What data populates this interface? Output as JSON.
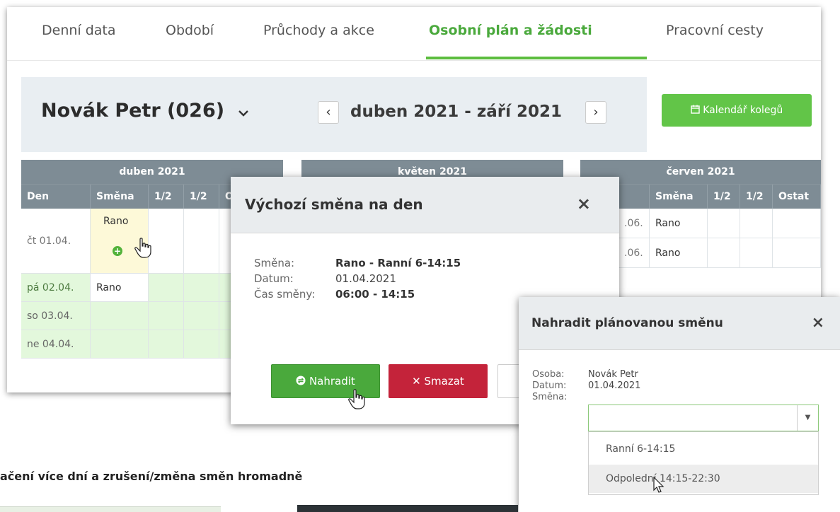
{
  "tabs": [
    {
      "label": "Denní data"
    },
    {
      "label": "Období"
    },
    {
      "label": "Průchody a akce"
    },
    {
      "label": "Osobní plán a žádosti",
      "active": true
    },
    {
      "label": "Pracovní cesty"
    }
  ],
  "header": {
    "person": "Novák Petr (026)",
    "period": "duben 2021 - září 2021",
    "prev_icon": "‹",
    "next_icon": "›",
    "colleagues_button": "Kalendář kolegů"
  },
  "months": [
    {
      "title": "duben 2021",
      "columns": [
        "Den",
        "Směna",
        "1/2",
        "1/2",
        "O"
      ],
      "rows": [
        {
          "day": "čt 01.04.",
          "shift": "Rano",
          "weekend": false
        },
        {
          "day": "pá 02.04.",
          "shift": "Rano",
          "weekend": false
        },
        {
          "day": "so 03.04.",
          "shift": "",
          "weekend": true
        },
        {
          "day": "ne 04.04.",
          "shift": "",
          "weekend": true
        }
      ]
    },
    {
      "title": "květen 2021"
    },
    {
      "title": "červen 2021",
      "columns": [
        "Směna",
        "1/2",
        "1/2",
        "Ostat"
      ],
      "rows": [
        {
          "day": ".06.",
          "shift": "Rano"
        },
        {
          "day": ".06.",
          "shift": "Rano"
        }
      ]
    }
  ],
  "dialog_default_shift": {
    "title": "Výchozí směna na den",
    "close": "×",
    "fields": [
      {
        "label": "Směna:",
        "value": "Rano - Ranní 6-14:15",
        "bold": true
      },
      {
        "label": "Datum:",
        "value": "01.04.2021",
        "bold": false
      },
      {
        "label": "Čas směny:",
        "value": "06:00 - 14:15",
        "bold": true
      }
    ],
    "buttons": {
      "replace": "Nahradit",
      "delete": "Smazat"
    }
  },
  "dialog_replace_shift": {
    "title": "Nahradit plánovanou směnu",
    "close": "×",
    "fields": [
      {
        "label": "Osoba:",
        "value": "Novák Petr"
      },
      {
        "label": "Datum:",
        "value": "01.04.2021"
      },
      {
        "label": "Směna:",
        "value": ""
      }
    ],
    "select_value": "",
    "options": [
      "Ranní 6-14:15",
      "Odpolední 14:15-22:30"
    ],
    "hovered_option": "Odpolední 14:15-22:30"
  },
  "caption": "ačení více dní a zrušení/změna směn hromadně",
  "colors": {
    "accent_green": "#4aa93c",
    "header_gray": "#7e8c95",
    "danger_red": "#c4233a",
    "weekend_green": "#e3f8dc"
  }
}
